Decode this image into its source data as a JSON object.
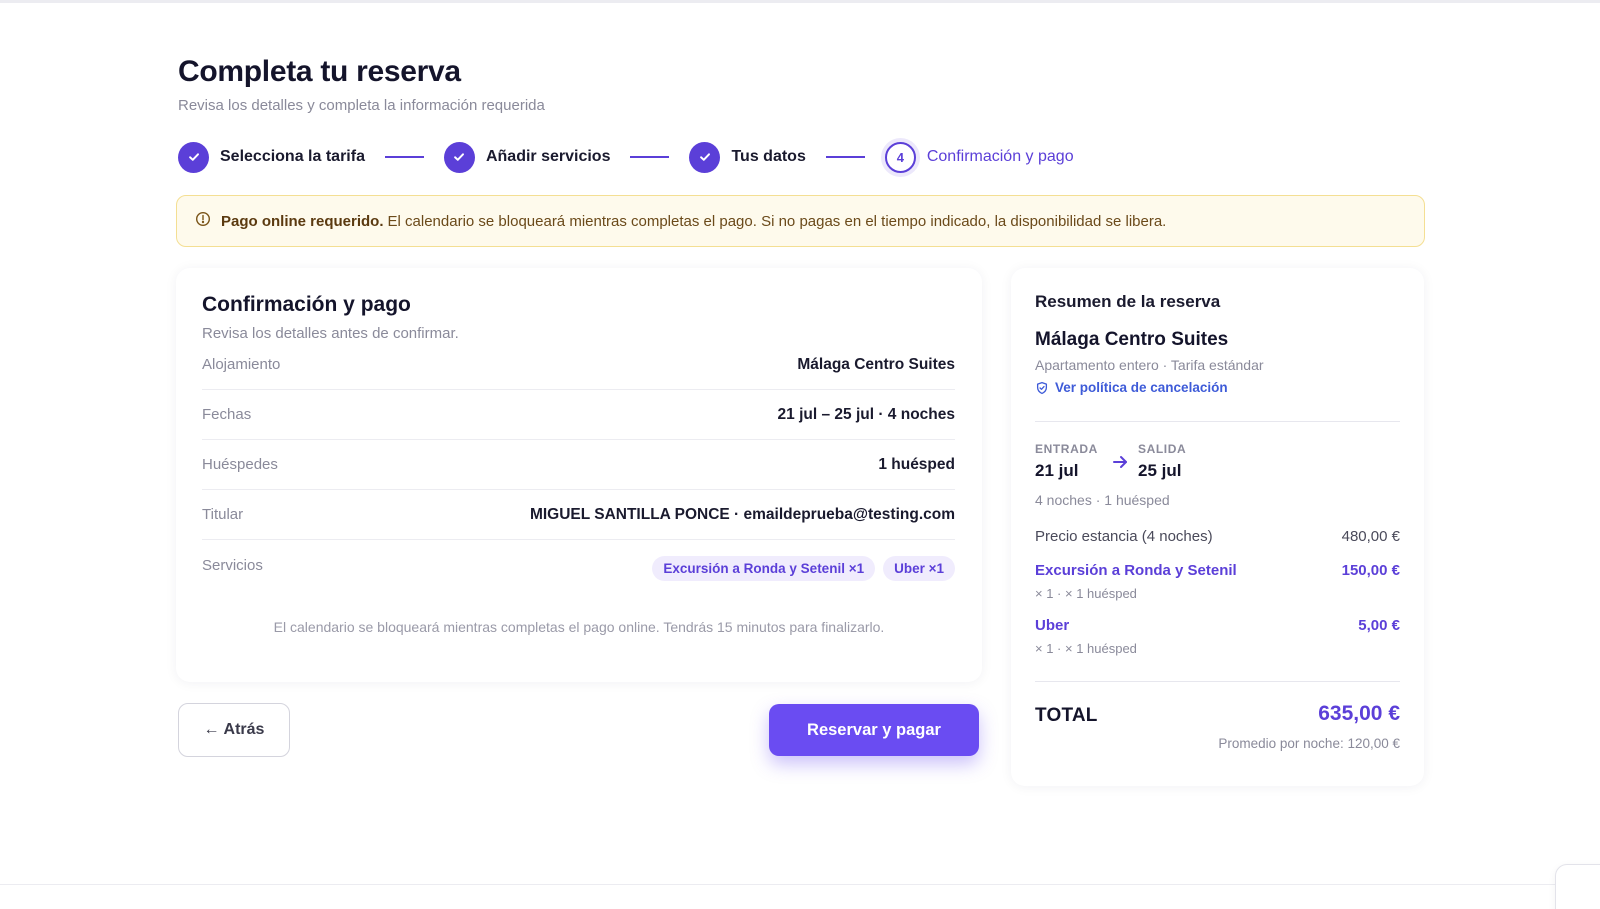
{
  "header": {
    "title": "Completa tu reserva",
    "subtitle": "Revisa los detalles y completa la información requerida"
  },
  "stepper": {
    "steps": [
      {
        "label": "Selecciona la tarifa",
        "state": "done"
      },
      {
        "label": "Añadir servicios",
        "state": "done"
      },
      {
        "label": "Tus datos",
        "state": "done"
      },
      {
        "label": "Confirmación y pago",
        "state": "current",
        "number": "4"
      }
    ]
  },
  "alert": {
    "strong": "Pago online requerido.",
    "text": "El calendario se bloqueará mientras completas el pago. Si no pagas en el tiempo indicado, la disponibilidad se libera.",
    "icon": "info-icon"
  },
  "confirmation": {
    "title": "Confirmación y pago",
    "subtitle": "Revisa los detalles antes de confirmar.",
    "rows": [
      {
        "label": "Alojamiento",
        "value": "Málaga Centro Suites"
      },
      {
        "label": "Fechas",
        "value": "21 jul – 25 jul · 4 noches"
      },
      {
        "label": "Huéspedes",
        "value": "1 huésped"
      },
      {
        "label": "Titular",
        "value": "MIGUEL SANTILLA PONCE · emaildeprueba@testing.com"
      }
    ],
    "services_label": "Servicios",
    "services": [
      "Excursión a Ronda y Setenil ×1",
      "Uber ×1"
    ],
    "note": "El calendario se bloqueará mientras completas el pago online. Tendrás 15 minutos para finalizarlo."
  },
  "actions": {
    "back_label": "Atrás",
    "back_icon": "arrow-left-icon",
    "pay_label": "Reservar y pagar"
  },
  "summary": {
    "heading": "Resumen de la reserva",
    "property": "Málaga Centro Suites",
    "property_sub": "Apartamento entero · Tarifa estándar",
    "policy_link": "Ver política de cancelación",
    "checkin_caption": "ENTRADA",
    "checkin": "21 jul",
    "checkout_caption": "SALIDA",
    "checkout": "25 jul",
    "stay_info": "4 noches · 1 huésped",
    "stay_price_label": "Precio estancia (4 noches)",
    "stay_price": "480,00 €",
    "services": [
      {
        "name": "Excursión a Ronda y Setenil",
        "price": "150,00 €",
        "meta": "× 1 · × 1 huésped"
      },
      {
        "name": "Uber",
        "price": "5,00 €",
        "meta": "× 1 · × 1 huésped"
      }
    ],
    "total_label": "TOTAL",
    "total": "635,00 €",
    "average": "Promedio por noche: 120,00 €"
  },
  "colors": {
    "accent": "#5b3fd8",
    "button": "#6a4cf2",
    "alert_bg": "#fefaec",
    "alert_border": "#f4df93"
  }
}
